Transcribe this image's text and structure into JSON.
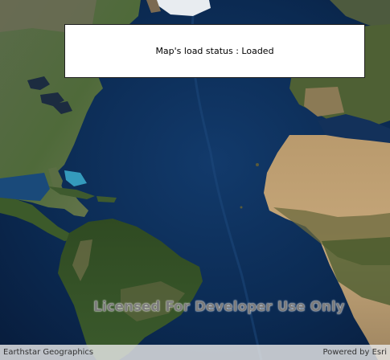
{
  "status_panel": {
    "text": "Map's load status : Loaded"
  },
  "map": {
    "watermark": "Licensed For Developer Use Only",
    "attribution": "Earthstar Geographics",
    "powered_by": "Powered by Esri"
  },
  "colors": {
    "ocean_deep": "#0d2a52",
    "ocean_shelf": "#2a7fb8",
    "land_green": "#3d5a2a",
    "land_desert": "#c9ac7f",
    "panel_bg": "#ffffff"
  }
}
